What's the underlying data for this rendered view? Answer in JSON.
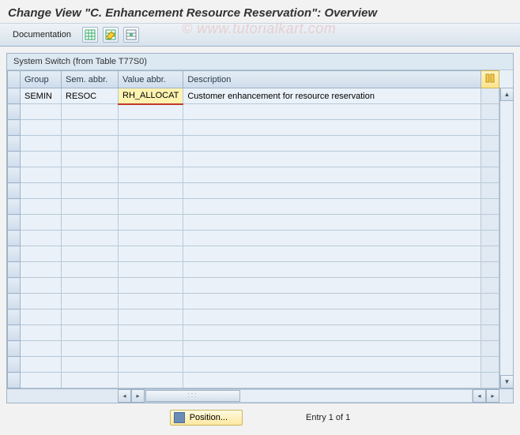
{
  "title": "Change View \"C. Enhancement Resource Reservation\": Overview",
  "toolbar": {
    "documentation_label": "Documentation"
  },
  "panel": {
    "title": "System Switch (from Table T77S0)"
  },
  "columns": {
    "group": "Group",
    "sem": "Sem. abbr.",
    "val": "Value abbr.",
    "desc": "Description"
  },
  "rows": [
    {
      "group": "SEMIN",
      "sem": "RESOC",
      "val": "RH_ALLOCAT",
      "desc": "Customer enhancement for resource reservation"
    }
  ],
  "footer": {
    "position_label": "Position...",
    "entry_text": "Entry 1 of 1"
  },
  "watermark": "© www.tutorialkart.com"
}
